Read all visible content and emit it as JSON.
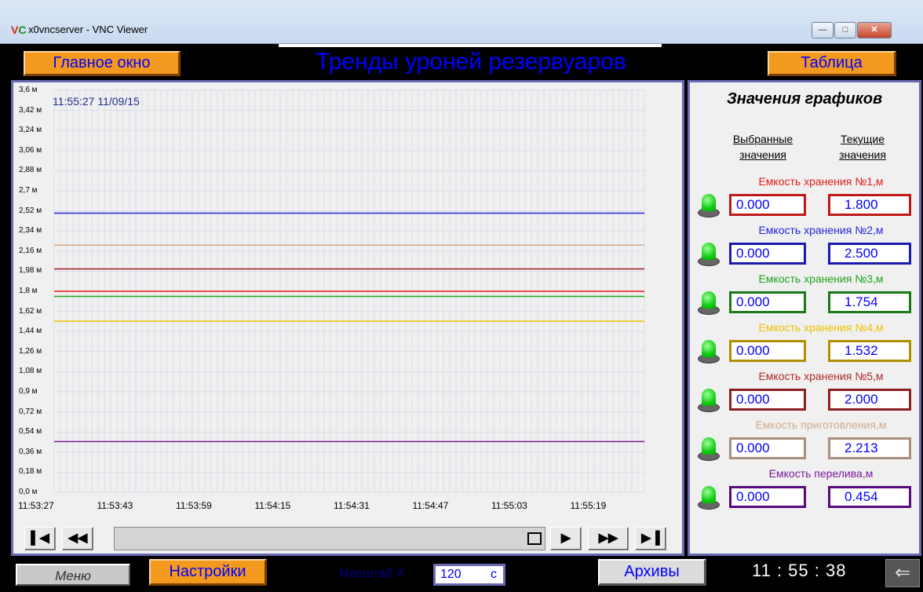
{
  "window": {
    "title": "x0vncserver - VNC Viewer",
    "icon_letters": "V",
    "icon_letters_2": "C"
  },
  "header": {
    "main_button": "Главное окно",
    "title": "Тренды уроней резервуаров",
    "table_button": "Таблица"
  },
  "chart": {
    "timestamp": "11:55:27  11/09/15"
  },
  "chart_data": {
    "type": "line",
    "ylim": [
      0,
      3.6
    ],
    "y_ticks": [
      "3,6 м",
      "3,42 м",
      "3,24 м",
      "3,06 м",
      "2,88 м",
      "2,7 м",
      "2,52 м",
      "2,34 м",
      "2,16 м",
      "1,98 м",
      "1,8 м",
      "1,62 м",
      "1,44 м",
      "1,26 м",
      "1,08 м",
      "0,9 м",
      "0,72 м",
      "0,54 м",
      "0,36 м",
      "0,18 м",
      "0,0 м"
    ],
    "x_ticks": [
      "11:53:27",
      "11:53:43",
      "11:53:59",
      "11:54:15",
      "11:54:31",
      "11:54:47",
      "11:55:03",
      "11:55:19"
    ],
    "grid": true,
    "series": [
      {
        "name": "Емкость хранения №1,м",
        "value": 1.8,
        "color": "#e41a1a"
      },
      {
        "name": "Емкость хранения №2,м",
        "value": 2.5,
        "color": "#2222dd"
      },
      {
        "name": "Емкость хранения №3,м",
        "value": 1.754,
        "color": "#1aa51a"
      },
      {
        "name": "Емкость хранения №4,м",
        "value": 1.532,
        "color": "#f0c000"
      },
      {
        "name": "Емкость хранения №5,м",
        "value": 2.0,
        "color": "#a02020"
      },
      {
        "name": "Емкость приготовления,м",
        "value": 2.213,
        "color": "#d2a98a"
      },
      {
        "name": "Емкость перелива,м",
        "value": 0.454,
        "color": "#7a1a9a"
      }
    ]
  },
  "navigation": {
    "first": "⏮",
    "rewind": "⏪",
    "play": "▶",
    "forward": "⏩",
    "last": "⏭"
  },
  "values_panel": {
    "title": "Значения графиков",
    "col_selected_1": "Выбранные",
    "col_selected_2": "значения",
    "col_current_1": "Текущие",
    "col_current_2": "значения",
    "rows": [
      {
        "label": "Емкость хранения №1,м",
        "selected": "0.000",
        "current": "1.800",
        "color": "#e41a1a",
        "border": "#c01818"
      },
      {
        "label": "Емкость хранения №2,м",
        "selected": "0.000",
        "current": "2.500",
        "color": "#2222dd",
        "border": "#1a1ab0"
      },
      {
        "label": "Емкость хранения №3,м",
        "selected": "0.000",
        "current": "1.754",
        "color": "#1aa51a",
        "border": "#1a7a1a"
      },
      {
        "label": "Емкость хранения №4,м",
        "selected": "0.000",
        "current": "1.532",
        "color": "#f0c000",
        "border": "#b09000"
      },
      {
        "label": "Емкость хранения №5,м",
        "selected": "0.000",
        "current": "2.000",
        "color": "#b02828",
        "border": "#8a2020"
      },
      {
        "label": "Емкость приготовления,м",
        "selected": "0.000",
        "current": "2.213",
        "color": "#d2a98a",
        "border": "#a89080"
      },
      {
        "label": "Емкость перелива,м",
        "selected": "0.000",
        "current": "0.454",
        "color": "#7a1a9a",
        "border": "#5a0a7a"
      }
    ]
  },
  "footer": {
    "menu_button": "Меню",
    "settings_button": "Настройки",
    "scale_label": "Масштаб Х",
    "scale_value": "120",
    "scale_unit": "с",
    "archive_button": "Архивы",
    "clock": "11 : 55 : 38"
  }
}
